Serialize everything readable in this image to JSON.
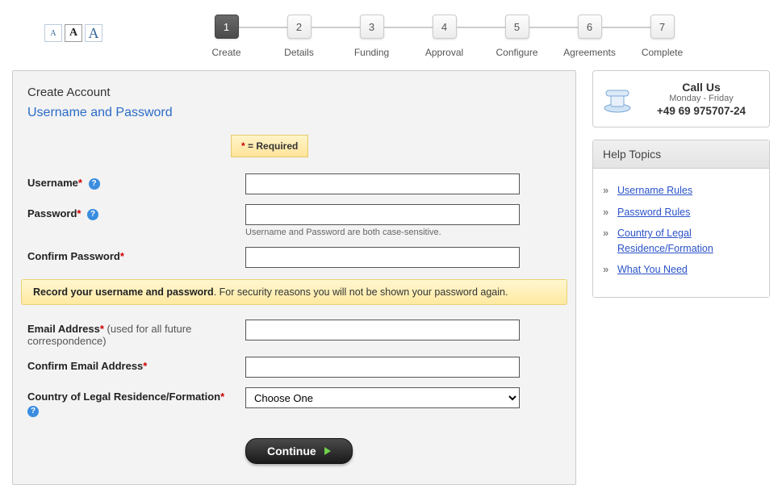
{
  "fontSwitcher": {
    "small": "A",
    "medium": "A",
    "large": "A"
  },
  "steps": [
    {
      "num": "1",
      "label": "Create",
      "active": true
    },
    {
      "num": "2",
      "label": "Details",
      "active": false
    },
    {
      "num": "3",
      "label": "Funding",
      "active": false
    },
    {
      "num": "4",
      "label": "Approval",
      "active": false
    },
    {
      "num": "5",
      "label": "Configure",
      "active": false
    },
    {
      "num": "6",
      "label": "Agreements",
      "active": false
    },
    {
      "num": "7",
      "label": "Complete",
      "active": false
    }
  ],
  "panel": {
    "title": "Create Account",
    "subtitle": "Username and Password",
    "requiredBadge": {
      "star": "*",
      "text": " = Required"
    }
  },
  "fields": {
    "username": {
      "label": "Username",
      "value": ""
    },
    "password": {
      "label": "Password",
      "value": ""
    },
    "caseHint": "Username and Password are both case-sensitive.",
    "confirmPassword": {
      "label": "Confirm Password",
      "value": ""
    },
    "email": {
      "label": "Email Address",
      "sub": " (used for all future correspondence)",
      "value": ""
    },
    "confirmEmail": {
      "label": "Confirm Email Address",
      "value": ""
    },
    "country": {
      "label": "Country of Legal Residence/Formation",
      "selected": "Choose One"
    }
  },
  "warning": {
    "bold": "Record your username and password",
    "rest": ". For security reasons you will not be shown your password again."
  },
  "continueLabel": "Continue",
  "callBox": {
    "title": "Call Us",
    "hours": "Monday - Friday",
    "number": "+49 69 975707-24"
  },
  "helpBox": {
    "header": "Help Topics",
    "links": [
      "Username Rules",
      "Password Rules",
      "Country of Legal Residence/Formation",
      "What You Need"
    ]
  }
}
